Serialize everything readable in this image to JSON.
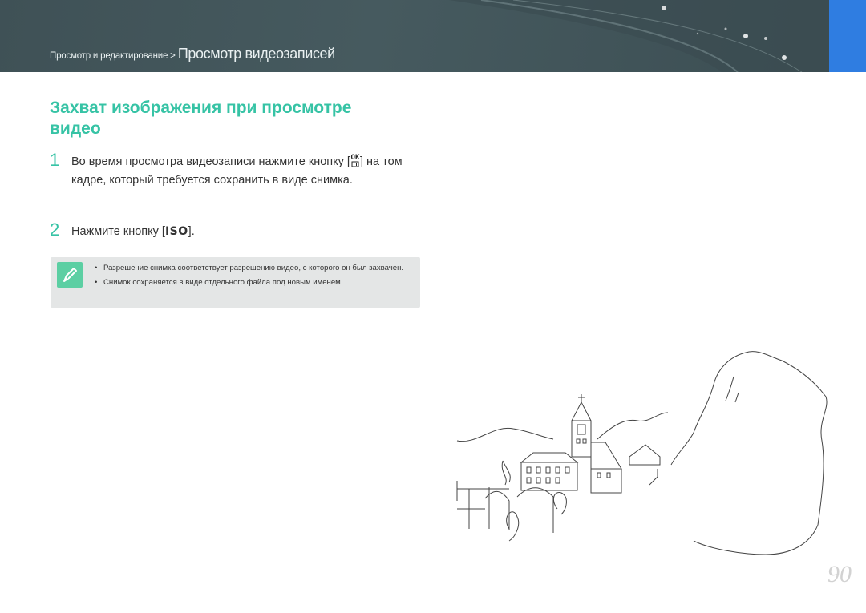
{
  "header": {
    "breadcrumb_parent": "Просмотр и редактирование",
    "breadcrumb_separator": ">",
    "breadcrumb_current": "Просмотр видеозаписей"
  },
  "section": {
    "title": "Захват изображения при просмотре видео"
  },
  "steps": [
    {
      "number": "1",
      "text_before": "Во время просмотра видеозаписи нажмите кнопку [",
      "key_top": "OK",
      "key_bottom": "",
      "text_after": "] на том кадре, который требуется сохранить в виде снимка."
    },
    {
      "number": "2",
      "text_before": "Нажмите кнопку [",
      "key": "ISO",
      "text_after": "]."
    }
  ],
  "note": {
    "icon": "pen-icon",
    "items": [
      "Разрешение снимка соответствует разрешению видео, с которого он был захвачен.",
      "Снимок сохраняется в виде отдельного файла под новым именем."
    ]
  },
  "page_number": "90",
  "colors": {
    "accent": "#36c3a5",
    "header_bg": "#455a5f",
    "side_tab": "#2f7de1",
    "note_bg": "#e4e6e6",
    "note_icon": "#5ccfa3"
  }
}
